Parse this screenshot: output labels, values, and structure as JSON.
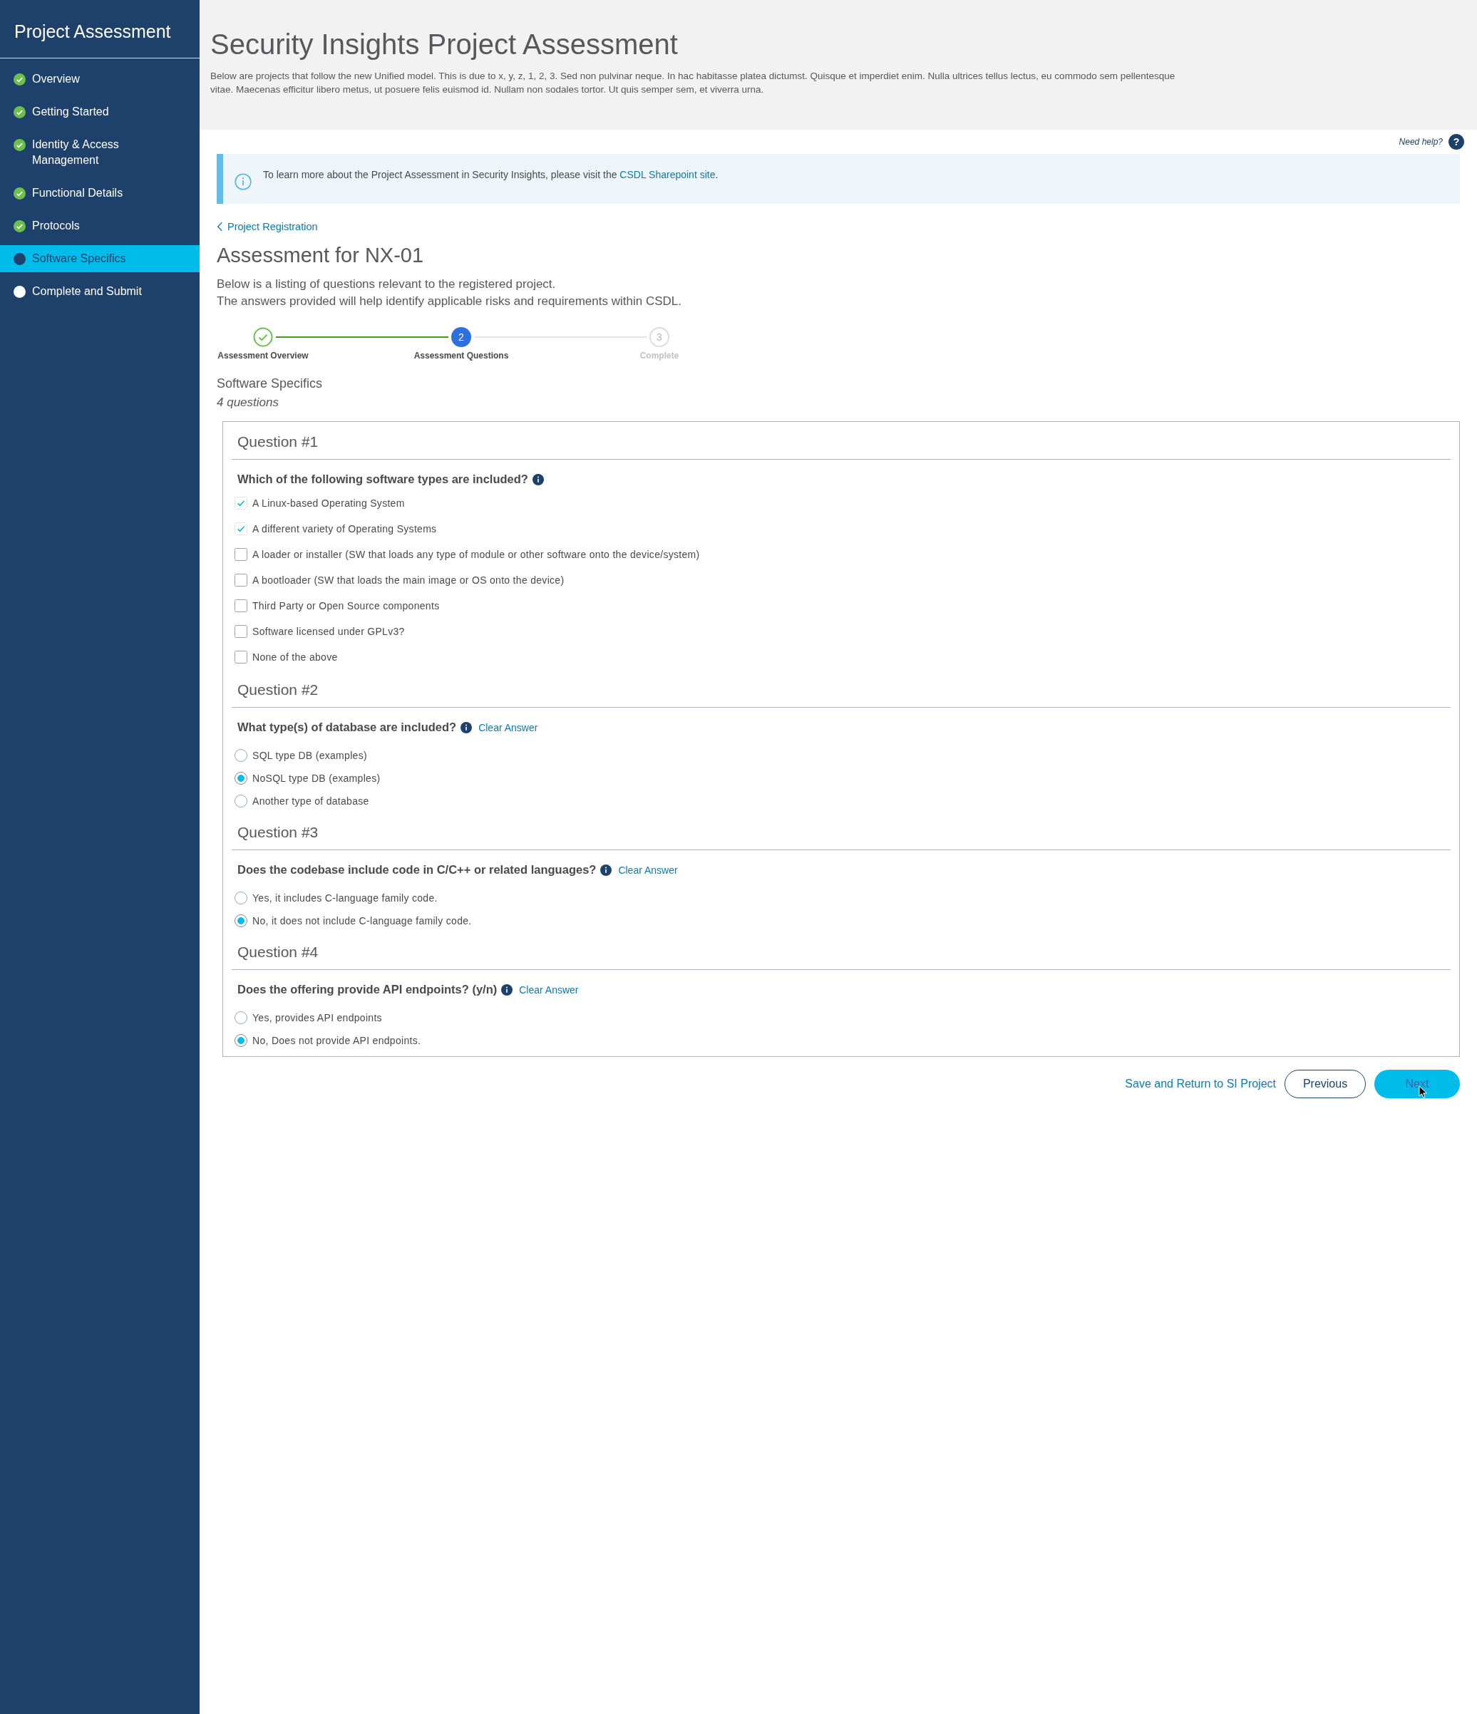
{
  "sidebar": {
    "title": "Project Assessment",
    "items": [
      {
        "label": "Overview",
        "completed": true,
        "selected": false
      },
      {
        "label": "Getting Started",
        "completed": true,
        "selected": false
      },
      {
        "label": "Identity & Access Management",
        "completed": true,
        "selected": false
      },
      {
        "label": "Functional Details",
        "completed": true,
        "selected": false
      },
      {
        "label": "Protocols",
        "completed": true,
        "selected": false
      },
      {
        "label": "Software Specifics",
        "completed": false,
        "selected": true
      },
      {
        "label": "Complete and Submit",
        "completed": false,
        "selected": false
      }
    ]
  },
  "header": {
    "title": "Security Insights Project Assessment",
    "description": "Below are projects that follow the new Unified model. This is due to x, y, z, 1, 2, 3. Sed non pulvinar neque. In hac habitasse platea dictumst. Quisque et imperdiet enim. Nulla ultrices tellus lectus, eu commodo sem pellentesque vitae. Maecenas efficitur libero metus, ut posuere felis euismod id. Nullam non sodales tortor. Ut quis semper sem, et viverra urna."
  },
  "help": {
    "label": "Need help?",
    "icon": "?"
  },
  "banner": {
    "text": "To learn more about the Project Assessment in Security Insights, please visit the ",
    "link": "CSDL Sharepoint site",
    "end": "."
  },
  "back_link": "Project Registration",
  "assessment": {
    "title": "Assessment for NX-01",
    "lines": [
      "Below is a listing of questions relevant to the registered project.",
      "The answers provided will help identify applicable risks and requirements within CSDL."
    ]
  },
  "steps": [
    {
      "label": "Assessment Overview",
      "kind": "done"
    },
    {
      "label": "Assessment Questions",
      "kind": "current",
      "number": "2"
    },
    {
      "label": "Complete",
      "kind": "pending",
      "number": "3"
    }
  ],
  "section": {
    "title": "Software Specifics",
    "count": "4 questions"
  },
  "questions": [
    {
      "heading": "Question #1",
      "text": "Which of the following software types are included?",
      "kind": "checkbox",
      "options": [
        {
          "label": "A Linux-based Operating System",
          "checked": true
        },
        {
          "label": "A different variety of Operating Systems",
          "checked": true
        },
        {
          "label": "A loader or installer (SW that loads any type of module or other software onto the device/system)",
          "checked": false
        },
        {
          "label": "A bootloader (SW that loads the main image or OS onto the device)",
          "checked": false
        },
        {
          "label": "Third Party or Open Source components",
          "checked": false
        },
        {
          "label": "Software licensed under GPLv3?",
          "checked": false
        },
        {
          "label": "None of the above",
          "checked": false
        }
      ]
    },
    {
      "heading": "Question #2",
      "text": "What type(s) of database are included?",
      "kind": "radio",
      "clear": "Clear Answer",
      "options": [
        {
          "label": "SQL type DB (examples)",
          "selected": false
        },
        {
          "label": "NoSQL type DB (examples)",
          "selected": true
        },
        {
          "label": "Another type of database",
          "selected": false
        }
      ]
    },
    {
      "heading": "Question #3",
      "text": "Does the codebase include code in C/C++ or related languages?",
      "kind": "radio",
      "clear": "Clear Answer",
      "options": [
        {
          "label": "Yes, it includes C-language family code.",
          "selected": false
        },
        {
          "label": "No, it does not include C-language family code.",
          "selected": true
        }
      ]
    },
    {
      "heading": "Question #4",
      "text": "Does the offering provide API endpoints? (y/n)",
      "kind": "radio",
      "clear": "Clear Answer",
      "options": [
        {
          "label": "Yes, provides API endpoints",
          "selected": false
        },
        {
          "label": "No, Does not provide API endpoints.",
          "selected": true
        }
      ]
    }
  ],
  "actions": {
    "save": "Save and Return to SI Project",
    "previous": "Previous",
    "next": "Next"
  }
}
